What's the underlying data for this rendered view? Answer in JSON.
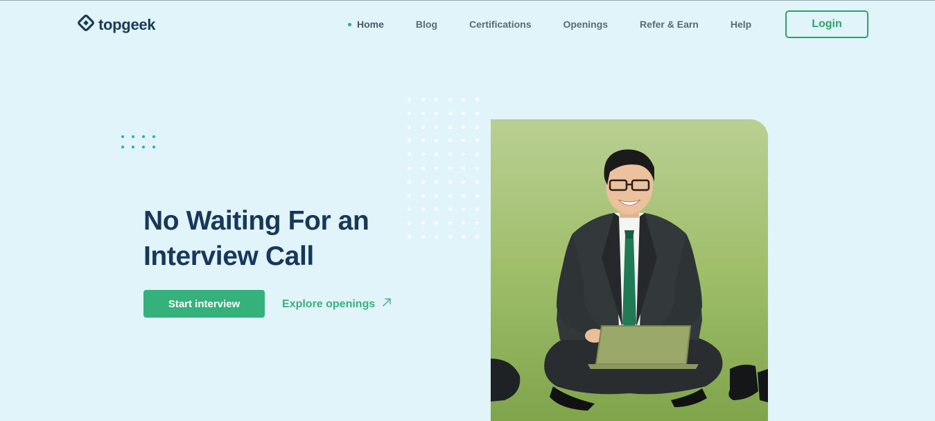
{
  "brand": {
    "name": "topgeek",
    "logo_icon": "diamond-logo-icon"
  },
  "nav": {
    "items": [
      {
        "label": "Home",
        "active": true
      },
      {
        "label": "Blog",
        "active": false
      },
      {
        "label": "Certifications",
        "active": false
      },
      {
        "label": "Openings",
        "active": false
      },
      {
        "label": "Refer & Earn",
        "active": false
      },
      {
        "label": "Help",
        "active": false
      }
    ],
    "login_label": "Login"
  },
  "hero": {
    "title_line1": "No Waiting For an",
    "title_line2": "Interview Call",
    "primary_cta": "Start interview",
    "secondary_cta": "Explore openings",
    "secondary_icon": "arrow-up-right-icon",
    "image_subject": "businessman-with-laptop-photo"
  },
  "colors": {
    "background": "#e0f4f9",
    "heading": "#17385a",
    "accent_green": "#35b27b",
    "dots_cyan": "#1fb0c4"
  }
}
